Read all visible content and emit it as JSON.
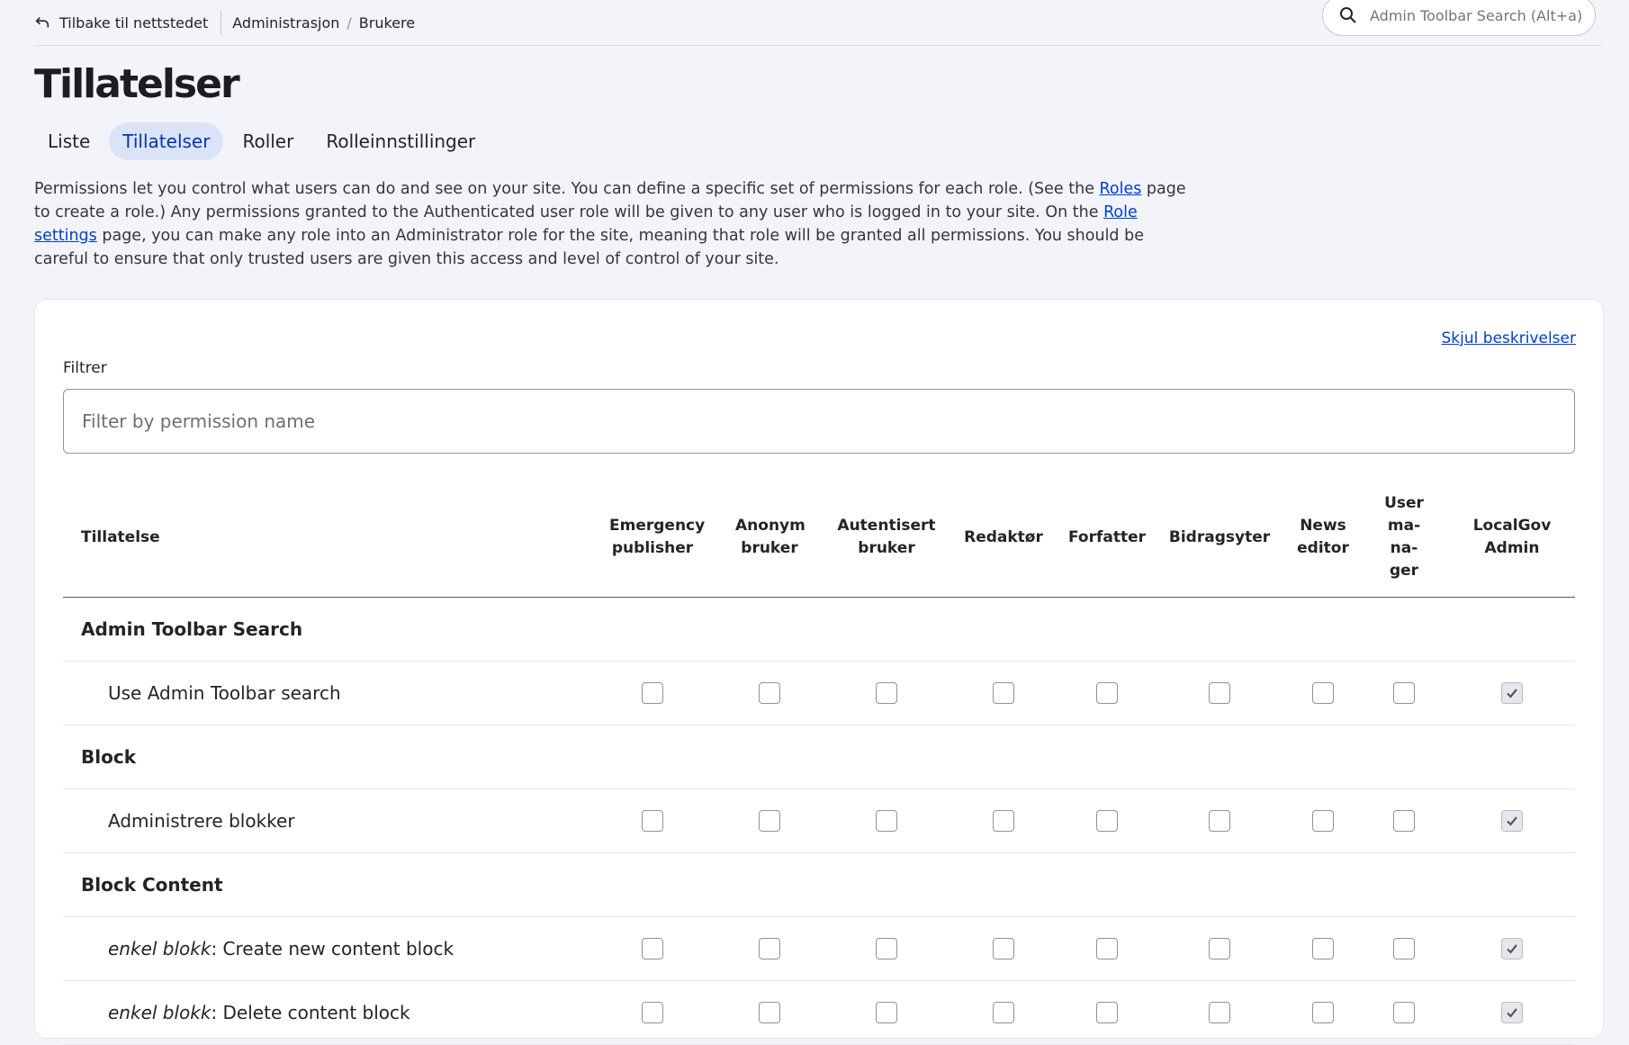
{
  "topbar": {
    "back_label": "Tilbake til nettstedet",
    "breadcrumbs": [
      "Administrasjon",
      "Brukere"
    ],
    "search_placeholder": "Admin Toolbar Search (Alt+a)"
  },
  "page_title": "Tillatelser",
  "tabs": [
    {
      "label": "Liste",
      "active": false
    },
    {
      "label": "Tillatelser",
      "active": true
    },
    {
      "label": "Roller",
      "active": false
    },
    {
      "label": "Rolleinnstillinger",
      "active": false
    }
  ],
  "description": {
    "part1": "Permissions let you control what users can do and see on your site. You can define a specific set of permissions for each role. (See the ",
    "roles_link": "Roles",
    "part2": " page to crea­te a role.) Any permissions granted to the Authenticated user role will be given to any user who is logged in to your site. On the ",
    "role_settings_link": "Role settings",
    "part3": " page, you can make any role into an Administrator role for the site, meaning that role will be granted all permissions. You should be careful to ensure that only trusted users are given this access and level of control of your site."
  },
  "panel": {
    "hide_descriptions": "Skjul beskrivelser",
    "filter_label": "Filtrer",
    "filter_placeholder": "Filter by permission name"
  },
  "table": {
    "permission_header": "Tillatelse",
    "roles": [
      "Emergency publisher",
      "Anonym bruker",
      "Autentisert bruker",
      "Redaktør",
      "Forfatter",
      "Bidragsyter",
      "News editor",
      "User ma­na­ger",
      "LocalGov Admin"
    ],
    "rows": [
      {
        "type": "group",
        "name": "Admin Toolbar Search"
      },
      {
        "type": "perm",
        "name": "Use Admin Toolbar search",
        "checked": [
          false,
          false,
          false,
          false,
          false,
          false,
          false,
          false,
          true
        ]
      },
      {
        "type": "group",
        "name": "Block"
      },
      {
        "type": "perm",
        "name": "Administrere blokker",
        "checked": [
          false,
          false,
          false,
          false,
          false,
          false,
          false,
          false,
          true
        ]
      },
      {
        "type": "group",
        "name": "Block Content"
      },
      {
        "type": "perm",
        "prefix": "enkel blokk",
        "name": ": Create new content block",
        "checked": [
          false,
          false,
          false,
          false,
          false,
          false,
          false,
          false,
          true
        ]
      },
      {
        "type": "perm",
        "prefix": "enkel blokk",
        "name": ": Delete content block",
        "checked": [
          false,
          false,
          false,
          false,
          false,
          false,
          false,
          false,
          true
        ]
      }
    ]
  }
}
